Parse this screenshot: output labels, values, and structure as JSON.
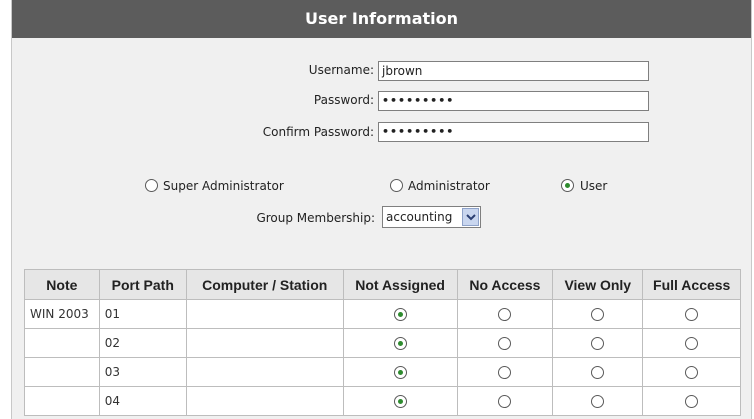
{
  "header": {
    "title": "User Information"
  },
  "form": {
    "username_label": "Username:",
    "username_value": "jbrown",
    "password_label": "Password:",
    "password_value": "•••••••••",
    "confirm_label": "Confirm Password:",
    "confirm_value": "•••••••••",
    "roles": [
      {
        "label": "Super Administrator",
        "checked": false
      },
      {
        "label": "Administrator",
        "checked": false
      },
      {
        "label": "User",
        "checked": true
      }
    ],
    "group_label": "Group Membership:",
    "group_value": "accounting"
  },
  "table": {
    "columns": [
      "Note",
      "Port Path",
      "Computer / Station",
      "Not Assigned",
      "No Access",
      "View Only",
      "Full Access"
    ],
    "rows": [
      {
        "note": "WIN 2003",
        "port": "01",
        "station": "",
        "selected": "Not Assigned"
      },
      {
        "note": "",
        "port": "02",
        "station": "",
        "selected": "Not Assigned"
      },
      {
        "note": "",
        "port": "03",
        "station": "",
        "selected": "Not Assigned"
      },
      {
        "note": "",
        "port": "04",
        "station": "",
        "selected": "Not Assigned"
      }
    ]
  },
  "colors": {
    "title_bar": "#5c5c5c",
    "panel_bg": "#f0f0f0",
    "radio_selected": "#2e8b2e",
    "select_arrow_bg": "#c9d6ef"
  }
}
